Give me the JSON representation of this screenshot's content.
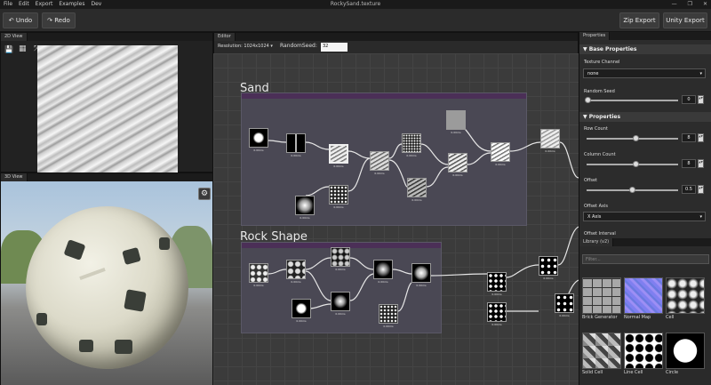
{
  "menu": [
    "File",
    "Edit",
    "Export",
    "Examples",
    "Dev"
  ],
  "app_title": "RockySand.texture",
  "window_controls": [
    "—",
    "❐",
    "✕"
  ],
  "toolbar": {
    "undo": "↶ Undo",
    "redo": "↷ Redo",
    "zip_export": "Zip Export",
    "unity_export": "Unity Export"
  },
  "panels": {
    "view2d": "2D View",
    "view3d": "3D View",
    "editor": "Editor",
    "properties": "Properties",
    "library": "Library (v2)"
  },
  "editor_bar": {
    "resolution": "Resolution: 1024x1024 ▾",
    "seed_label": "RandomSeed:",
    "seed_value": "32"
  },
  "groups": {
    "sand": "Sand",
    "rock": "Rock Shape"
  },
  "properties": {
    "base_header": "▼ Base Properties",
    "texture_channel_label": "Texture Channel",
    "texture_channel_value": "none",
    "random_seed_label": "Random Seed",
    "random_seed_value": "0",
    "props_header": "▼ Properties",
    "row_count_label": "Row Count",
    "row_count_value": "8",
    "column_count_label": "Column Count",
    "column_count_value": "8",
    "offset_label": "Offset",
    "offset_value": "0.5",
    "offset_axis_label": "Offset Axis",
    "offset_axis_value": "X Axis",
    "offset_interval_label": "Offset Interval"
  },
  "library": {
    "search_placeholder": "Filter...",
    "items": [
      {
        "label": "Brick Generator"
      },
      {
        "label": "Normal Map"
      },
      {
        "label": "Cell"
      },
      {
        "label": "Solid Cell"
      },
      {
        "label": "Line Cell"
      },
      {
        "label": "Circle"
      }
    ]
  },
  "colors": {
    "group_header": "#4b2f57",
    "graph_bg": "#3b3b3b",
    "normal_map": "#7f7ff0"
  }
}
